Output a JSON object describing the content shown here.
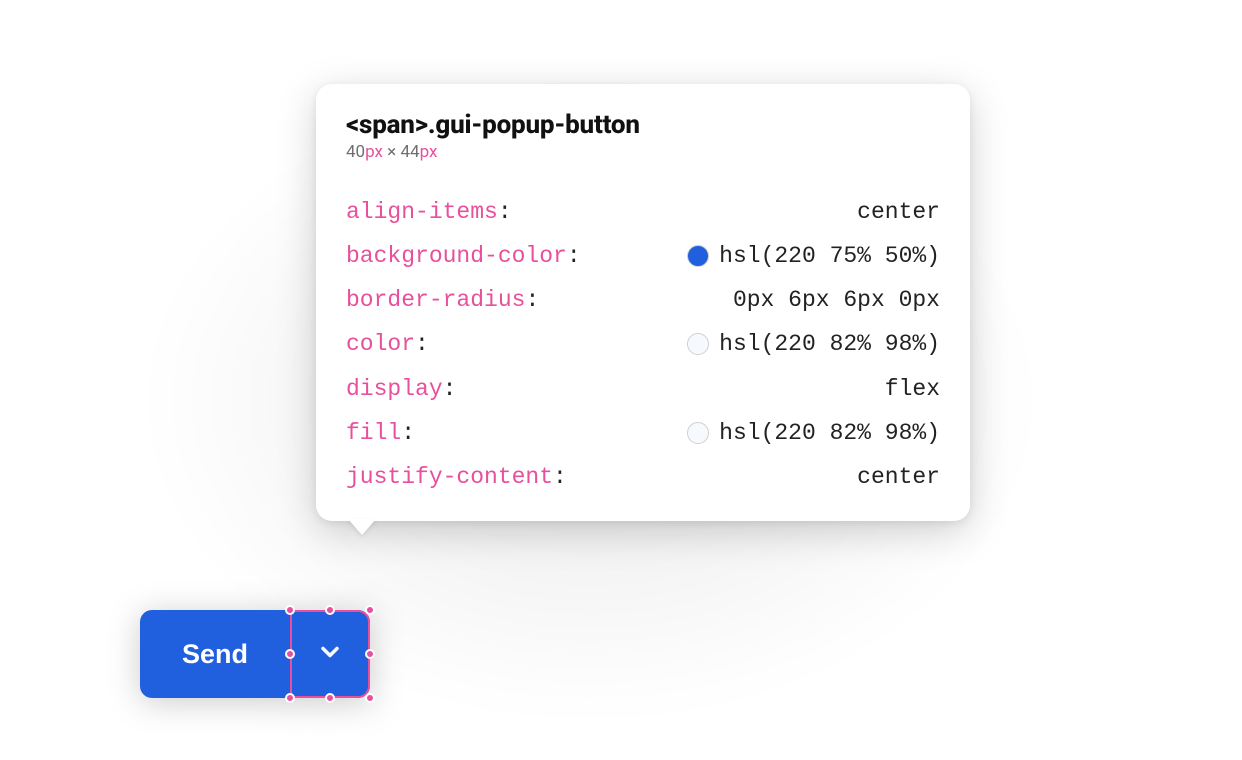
{
  "tooltip": {
    "selector": "<span>.gui-popup-button",
    "dimensions": {
      "w": "40",
      "h": "44",
      "unit": "px",
      "sep": " × "
    },
    "props": [
      {
        "name": "align-items",
        "value": "center"
      },
      {
        "name": "background-color",
        "value": "hsl(220 75% 50%)",
        "swatch": "hsl(220,75%,50%)"
      },
      {
        "name": "border-radius",
        "value": "0px 6px 6px 0px"
      },
      {
        "name": "color",
        "value": "hsl(220 82% 98%)",
        "swatch": "hsl(220,82%,98%)"
      },
      {
        "name": "display",
        "value": "flex"
      },
      {
        "name": "fill",
        "value": "hsl(220 82% 98%)",
        "swatch": "hsl(220,82%,98%)"
      },
      {
        "name": "justify-content",
        "value": "center"
      }
    ]
  },
  "button": {
    "send_label": "Send"
  },
  "colors": {
    "accent": "hsl(220 75% 50%)",
    "pink": "#e84f9c"
  }
}
